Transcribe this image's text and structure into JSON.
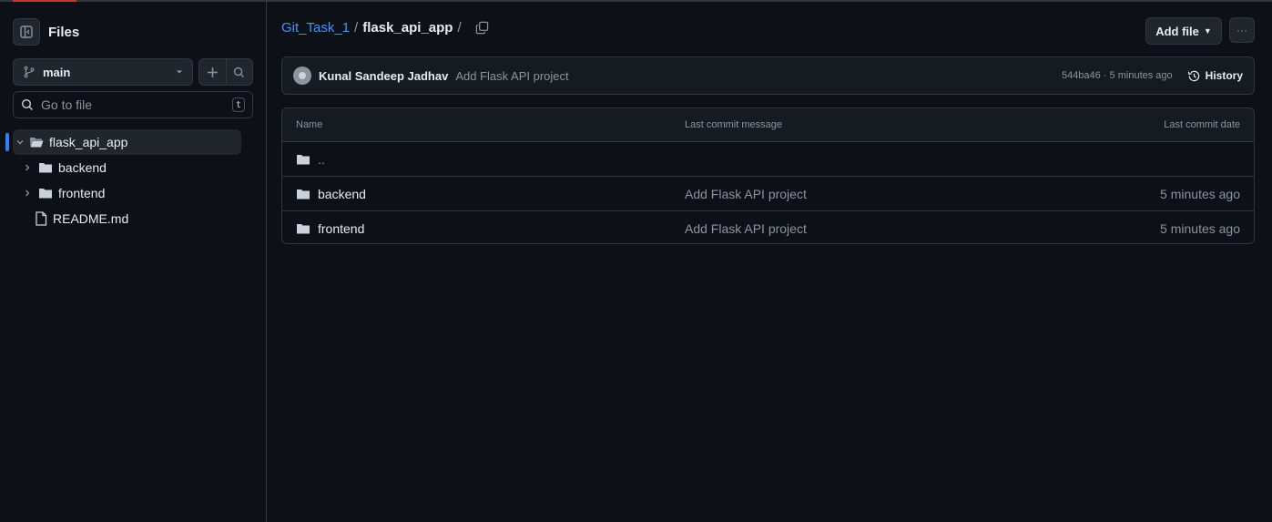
{
  "sidebar": {
    "title": "Files",
    "branch": "main",
    "goto_placeholder": "Go to file",
    "goto_shortcut": "t",
    "tree": [
      {
        "name": "flask_api_app",
        "type": "folder-open",
        "expanded": true,
        "active": true
      },
      {
        "name": "backend",
        "type": "folder"
      },
      {
        "name": "frontend",
        "type": "folder"
      },
      {
        "name": "README.md",
        "type": "file"
      }
    ]
  },
  "breadcrumb": {
    "repo": "Git_Task_1",
    "separator": "/",
    "current": "flask_api_app",
    "trailing": "/"
  },
  "actions": {
    "add_file": "Add file",
    "more": "···"
  },
  "commit": {
    "author": "Kunal Sandeep Jadhav",
    "message": "Add Flask API project",
    "meta": "544ba46 · 5 minutes ago",
    "history": "History"
  },
  "table": {
    "headers": {
      "name": "Name",
      "message": "Last commit message",
      "date": "Last commit date"
    },
    "parent": "..",
    "rows": [
      {
        "name": "backend",
        "message": "Add Flask API project",
        "date": "5 minutes ago"
      },
      {
        "name": "frontend",
        "message": "Add Flask API project",
        "date": "5 minutes ago"
      }
    ]
  },
  "colors": {
    "background": "#0d1117",
    "border": "#30363d",
    "link": "#4493f8",
    "muted": "#8b949e",
    "active_indicator": "#2f81f7"
  }
}
